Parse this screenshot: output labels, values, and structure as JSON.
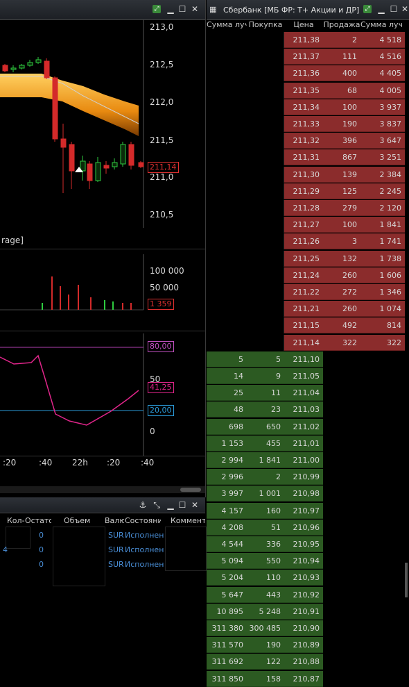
{
  "chart": {
    "price_axis": [
      "213,0",
      "212,5",
      "212,0",
      "211,5",
      "211,0",
      "210,5"
    ],
    "current_price": "211,14",
    "legend_fragment": "rage]",
    "volume_axis": [
      "100 000",
      "50 000"
    ],
    "volume_current": "1 359",
    "rsi_axis": [
      "80,00",
      "50",
      "20,00",
      "0"
    ],
    "rsi_current": "41,25",
    "time_axis": [
      ":20",
      ":40",
      "22h",
      ":20",
      ":40"
    ],
    "colors": {
      "up": "#2ecc40",
      "down": "#d42a2a",
      "band": "#f0a020",
      "rsi": "#e0258a",
      "level_high": "#c040c0",
      "level_low": "#2a9ad8"
    }
  },
  "orders": {
    "columns": [
      "Кол-",
      "Остато",
      "Объем",
      "Валю",
      "Состояние",
      "Коммент"
    ],
    "rows": [
      {
        "qty": "",
        "rest": "0",
        "cur": "SUR",
        "state": "Исполнен"
      },
      {
        "qty": "4",
        "rest": "0",
        "cur": "SUR",
        "state": "Исполнен"
      },
      {
        "qty": "",
        "rest": "0",
        "cur": "SUR",
        "state": "Исполнен"
      }
    ]
  },
  "book": {
    "title": "Сбербанк [МБ ФР: Т+ Акции и ДР]",
    "columns": [
      "Сумма луч",
      "Покупка",
      "Цена",
      "Продажа",
      "Сумма луч"
    ],
    "asks": [
      {
        "price": "211,38",
        "sell": "2",
        "sum": "4 518"
      },
      {
        "price": "211,37",
        "sell": "111",
        "sum": "4 516"
      },
      {
        "price": "211,36",
        "sell": "400",
        "sum": "4 405"
      },
      {
        "price": "211,35",
        "sell": "68",
        "sum": "4 005"
      },
      {
        "price": "211,34",
        "sell": "100",
        "sum": "3 937"
      },
      {
        "price": "211,33",
        "sell": "190",
        "sum": "3 837"
      },
      {
        "price": "211,32",
        "sell": "396",
        "sum": "3 647"
      },
      {
        "price": "211,31",
        "sell": "867",
        "sum": "3 251"
      },
      {
        "price": "211,30",
        "sell": "139",
        "sum": "2 384"
      },
      {
        "price": "211,29",
        "sell": "125",
        "sum": "2 245"
      },
      {
        "price": "211,28",
        "sell": "279",
        "sum": "2 120"
      },
      {
        "price": "211,27",
        "sell": "100",
        "sum": "1 841"
      },
      {
        "price": "211,26",
        "sell": "3",
        "sum": "1 741"
      },
      {
        "price": "211,25",
        "sell": "132",
        "sum": "1 738"
      },
      {
        "price": "211,24",
        "sell": "260",
        "sum": "1 606"
      },
      {
        "price": "211,22",
        "sell": "272",
        "sum": "1 346"
      },
      {
        "price": "211,21",
        "sell": "260",
        "sum": "1 074"
      },
      {
        "price": "211,15",
        "sell": "492",
        "sum": "814"
      },
      {
        "price": "211,14",
        "sell": "322",
        "sum": "322"
      }
    ],
    "bids": [
      {
        "sum": "5",
        "buy": "5",
        "price": "211,10"
      },
      {
        "sum": "14",
        "buy": "9",
        "price": "211,05"
      },
      {
        "sum": "25",
        "buy": "11",
        "price": "211,04"
      },
      {
        "sum": "48",
        "buy": "23",
        "price": "211,03"
      },
      {
        "sum": "698",
        "buy": "650",
        "price": "211,02"
      },
      {
        "sum": "1 153",
        "buy": "455",
        "price": "211,01"
      },
      {
        "sum": "2 994",
        "buy": "1 841",
        "price": "211,00"
      },
      {
        "sum": "2 996",
        "buy": "2",
        "price": "210,99"
      },
      {
        "sum": "3 997",
        "buy": "1 001",
        "price": "210,98"
      },
      {
        "sum": "4 157",
        "buy": "160",
        "price": "210,97"
      },
      {
        "sum": "4 208",
        "buy": "51",
        "price": "210,96"
      },
      {
        "sum": "4 544",
        "buy": "336",
        "price": "210,95"
      },
      {
        "sum": "5 094",
        "buy": "550",
        "price": "210,94"
      },
      {
        "sum": "5 204",
        "buy": "110",
        "price": "210,93"
      },
      {
        "sum": "5 647",
        "buy": "443",
        "price": "210,92"
      },
      {
        "sum": "10 895",
        "buy": "5 248",
        "price": "210,91"
      },
      {
        "sum": "311 380",
        "buy": "300 485",
        "price": "210,90"
      },
      {
        "sum": "311 570",
        "buy": "190",
        "price": "210,89"
      },
      {
        "sum": "311 692",
        "buy": "122",
        "price": "210,88"
      },
      {
        "sum": "311 850",
        "buy": "158",
        "price": "210,87"
      }
    ]
  }
}
